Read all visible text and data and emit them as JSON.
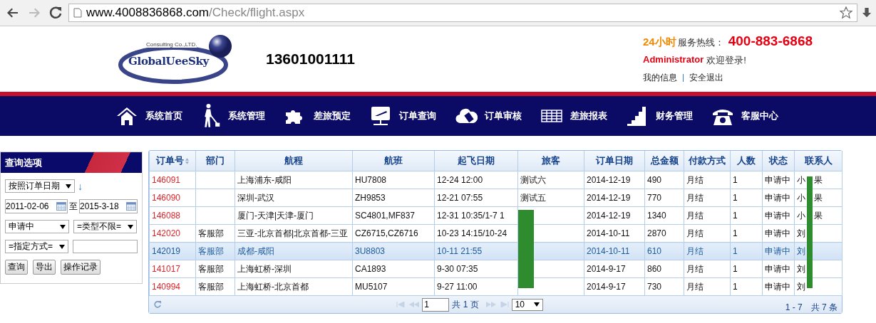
{
  "browser": {
    "url_host": "www.4008836868.com",
    "url_path": "/Check/flight.aspx",
    "forward_disabled": true
  },
  "header": {
    "logo_name": "GlobalUeeSky",
    "logo_tagline": "Consulting Co.,LTD.",
    "account": "13601001111",
    "hotline_badge": "24小时",
    "hotline_label": "服务热线：",
    "hotline": "400-883-6868",
    "user": "Administrator",
    "welcome": "欢迎登录!",
    "links": [
      "我的信息",
      "安全退出"
    ]
  },
  "nav": [
    {
      "label": "系统首页",
      "kind": "home"
    },
    {
      "label": "系统管理",
      "kind": "walker"
    },
    {
      "label": "差旅预定",
      "kind": "puzzle"
    },
    {
      "label": "订单查询",
      "kind": "monitor"
    },
    {
      "label": "订单审核",
      "kind": "cloud"
    },
    {
      "label": "差旅报表",
      "kind": "grid"
    },
    {
      "label": "财务管理",
      "kind": "stairs"
    },
    {
      "label": "客服中心",
      "kind": "phone"
    }
  ],
  "query": {
    "title": "查询选项",
    "date_type": "按照订单日期",
    "sort_arrow": "↓",
    "date_from": "2011-02-06",
    "to_label": "至",
    "date_to": "2015-3-18",
    "status": "申请中",
    "type": "=类型不限=",
    "method": "=指定方式=",
    "buttons": [
      "查询",
      "导出",
      "操作记录"
    ]
  },
  "table": {
    "columns": [
      {
        "label": "订单号",
        "sortable": true
      },
      {
        "label": "部门",
        "sortable": false
      },
      {
        "label": "航程",
        "sortable": false
      },
      {
        "label": "航班",
        "sortable": false
      },
      {
        "label": "起飞日期",
        "sortable": false
      },
      {
        "label": "旅客",
        "sortable": false
      },
      {
        "label": "订单日期",
        "sortable": false
      },
      {
        "label": "总金额",
        "sortable": false
      },
      {
        "label": "付款方式",
        "sortable": false
      },
      {
        "label": "人数",
        "sortable": false
      },
      {
        "label": "状态",
        "sortable": false
      },
      {
        "label": "联系人",
        "sortable": false
      }
    ],
    "rows": [
      {
        "selected": false,
        "cells": [
          "146091",
          "",
          "上海浦东-咸阳",
          "HU7808",
          "12-24 12:00",
          "测试六",
          "2014-12-19",
          "490",
          "月结",
          "1",
          "申请中",
          "小　果"
        ]
      },
      {
        "selected": false,
        "cells": [
          "146090",
          "",
          "深圳-武汉",
          "ZH9853",
          "12-21 07:55",
          "测试五",
          "2014-12-19",
          "770",
          "月结",
          "1",
          "申请中",
          "小　果"
        ]
      },
      {
        "selected": false,
        "cells": [
          "146088",
          "",
          "厦门-天津|天津-厦门",
          "SC4801,MF837",
          "12-31 10:35/1-7 1",
          "",
          "2014-12-19",
          "1340",
          "月结",
          "1",
          "申请中",
          "小　果"
        ]
      },
      {
        "selected": false,
        "cells": [
          "142020",
          "客服部",
          "三亚-北京首都|北京首都-三亚",
          "CZ6715,CZ6716",
          "10-23 14:15/10-24",
          "",
          "2014-10-11",
          "2870",
          "月结",
          "1",
          "申请中",
          "刘"
        ]
      },
      {
        "selected": true,
        "cells": [
          "142019",
          "客服部",
          "成都-咸阳",
          "3U8803",
          "10-11 21:55",
          "",
          "2014-10-11",
          "610",
          "月结",
          "1",
          "申请中",
          "刘"
        ]
      },
      {
        "selected": false,
        "cells": [
          "141017",
          "客服部",
          "上海虹桥-深圳",
          "CA1893",
          "9-30 07:35",
          "",
          "2014-9-17",
          "860",
          "月结",
          "1",
          "申请中",
          "刘"
        ]
      },
      {
        "selected": false,
        "cells": [
          "140994",
          "客服部",
          "上海虹桥-北京首都",
          "MU5107",
          "9-27 11:00",
          "",
          "2014-9-17",
          "730",
          "月结",
          "1",
          "申请中",
          "刘"
        ]
      }
    ]
  },
  "pager": {
    "page": "1",
    "total_pages": "共 1 页",
    "page_size": "10",
    "summary": "1 - 7　共 7 条"
  }
}
